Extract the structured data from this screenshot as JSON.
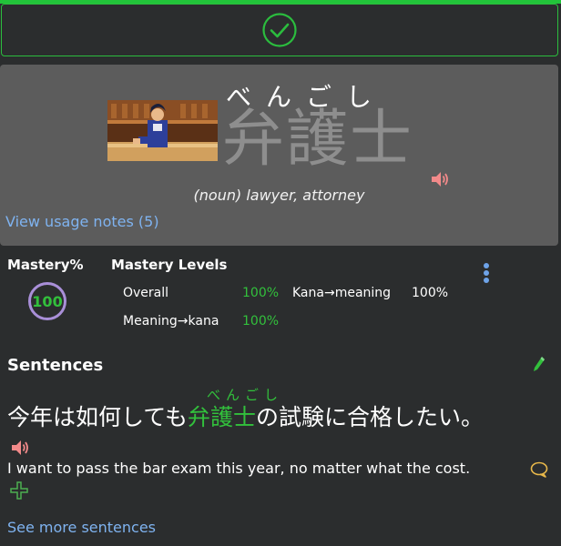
{
  "colors": {
    "accent_green": "#32c03c",
    "link_blue": "#7fb3f0",
    "card_bg": "#5c5c5c",
    "page_bg": "#2b2d2e",
    "speaker_pink": "#f28a8a"
  },
  "banner": {
    "icon": "check-circle-icon"
  },
  "word": {
    "furigana": "べんごし",
    "kanji": "弁護士",
    "pos": "(noun)",
    "meaning": "lawyer, attorney",
    "usage_notes_link": "View usage notes (5)",
    "audio_icon": "speaker-icon",
    "image_icon": "courtroom-image"
  },
  "mastery": {
    "title": "Mastery%",
    "percent": "100",
    "levels_title": "Mastery Levels",
    "levels": [
      {
        "label": "Overall",
        "value": "100%"
      },
      {
        "label": "Kana→meaning",
        "value": "100%"
      },
      {
        "label": "Meaning→kana",
        "value": "100%"
      }
    ],
    "menu_icon": "vertical-dots-icon"
  },
  "sentences": {
    "title": "Sentences",
    "edit_icon": "pencil-icon",
    "furigana": "べんごし",
    "jp_before": "今年は如何しても",
    "jp_highlight": "弁護士",
    "jp_after": "の試験に合格したい。",
    "en": "I want to pass the bar exam this year, no matter what the cost.",
    "audio_icon": "speaker-icon",
    "comment_icon": "comment-icon",
    "add_icon": "plus-icon",
    "see_more": "See more sentences"
  }
}
